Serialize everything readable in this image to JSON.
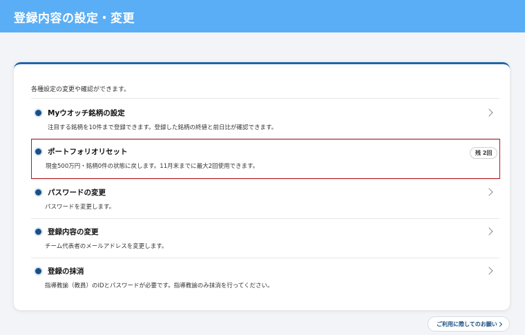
{
  "header": {
    "title": "登録内容の設定・変更"
  },
  "intro": "各種設定の変更や確認ができます。",
  "items": [
    {
      "title": "Myウオッチ銘柄の設定",
      "desc": "注目する銘柄を10件まで登録できます。登録した銘柄の終値と前日比が確認できます。",
      "icon": "chevron-right-icon"
    },
    {
      "title": "ポートフォリオリセット",
      "desc": "現金500万円・銘柄0件の状態に戻します。11月末までに最大2回使用できます。",
      "badge": "残 2回"
    },
    {
      "title": "パスワードの変更",
      "desc": "パスワードを変更します。",
      "icon": "chevron-right-icon"
    },
    {
      "title": "登録内容の変更",
      "desc": "チーム代表者のメールアドレスを変更します。",
      "icon": "chevron-right-icon"
    },
    {
      "title": "登録の抹消",
      "desc": "指導教諭（教員）のIDとパスワードが必要です。指導教諭のみ抹消を行ってください。",
      "icon": "chevron-right-icon"
    }
  ],
  "footer": {
    "help_label": "ご利用に際してのお願い"
  },
  "colors": {
    "header_bg": "#5aaef5",
    "accent": "#1a4f86",
    "highlight_border": "#b3141c"
  }
}
